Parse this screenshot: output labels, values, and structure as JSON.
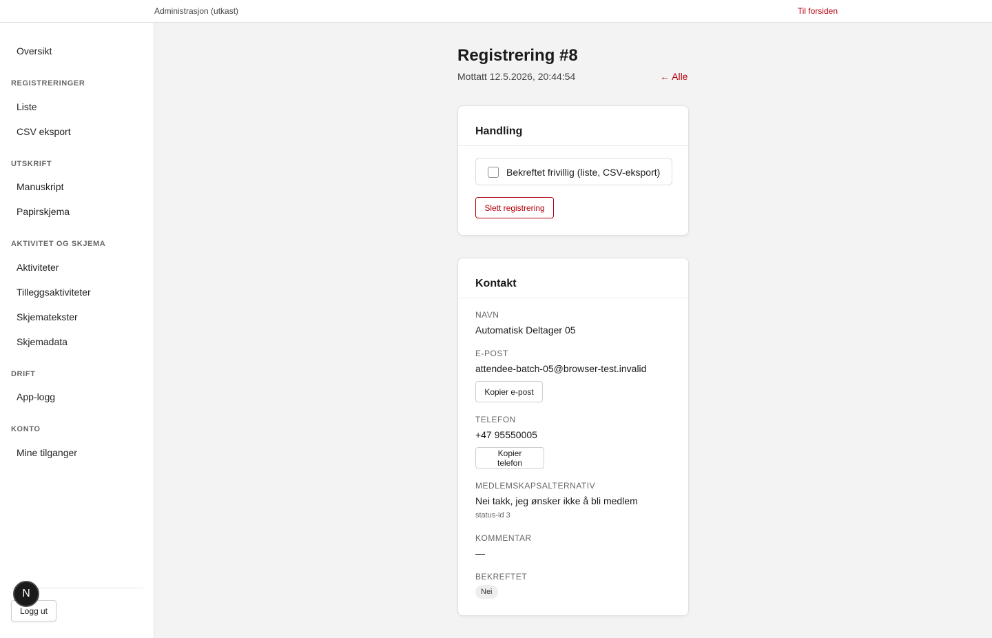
{
  "topbar": {
    "brand": "Administrasjon (utkast)",
    "home_link": "Til forsiden"
  },
  "sidebar": {
    "overview": "Oversikt",
    "sections": [
      {
        "heading": "REGISTRERINGER",
        "items": [
          "Liste",
          "CSV eksport"
        ]
      },
      {
        "heading": "UTSKRIFT",
        "items": [
          "Manuskript",
          "Papirskjema"
        ]
      },
      {
        "heading": "AKTIVITET OG SKJEMA",
        "items": [
          "Aktiviteter",
          "Tilleggsaktiviteter",
          "Skjematekster",
          "Skjemadata"
        ]
      },
      {
        "heading": "DRIFT",
        "items": [
          "App-logg"
        ]
      },
      {
        "heading": "KONTO",
        "items": [
          "Mine tilganger"
        ]
      }
    ],
    "logout": "Logg ut",
    "badge": "N"
  },
  "page": {
    "title": "Registrering #8",
    "received": "Mottatt 12.5.2026, 20:44:54",
    "back_link": "← Alle"
  },
  "action_card": {
    "title": "Handling",
    "confirm_label": "Bekreftet frivillig (liste, CSV-eksport)",
    "confirmed": false,
    "delete_label": "Slett registrering"
  },
  "contact_card": {
    "title": "Kontakt",
    "name_label": "NAVN",
    "name": "Automatisk Deltager 05",
    "email_label": "E-POST",
    "email": "attendee-batch-05@browser-test.invalid",
    "copy_email": "Kopier e-post",
    "phone_label": "TELEFON",
    "phone": "+47 95550005",
    "copy_phone": "Kopier telefon",
    "membership_label": "MEDLEMSKAPSALTERNATIV",
    "membership": "Nei takk, jeg ønsker ikke å bli medlem",
    "membership_status": "status-id 3",
    "comment_label": "KOMMENTAR",
    "comment": "—",
    "confirmed_label": "BEKREFTET",
    "confirmed_value": "Nei"
  },
  "colors": {
    "accent": "#b3000c",
    "background": "#f3f3f3"
  }
}
